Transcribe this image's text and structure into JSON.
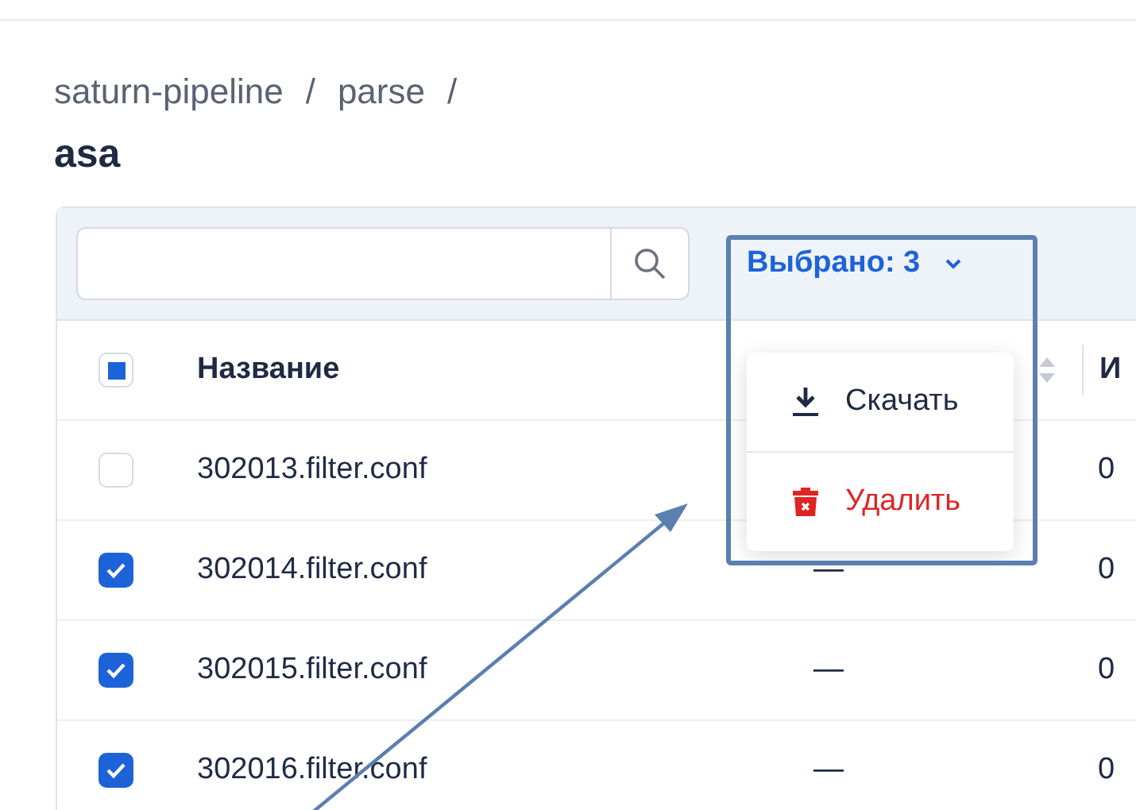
{
  "breadcrumb": [
    {
      "label": "saturn-pipeline",
      "separator": "/"
    },
    {
      "label": "parse",
      "separator": "/"
    }
  ],
  "title": "asa",
  "selection_button": {
    "label": "Выбрано: 3",
    "expanded": true
  },
  "menu": {
    "items": [
      {
        "kind": "download",
        "label": "Скачать"
      },
      {
        "kind": "delete",
        "label": "Удалить"
      }
    ]
  },
  "table": {
    "select_all": {
      "indeterminate": true
    },
    "columns": [
      {
        "kind": "text",
        "label": "Название"
      },
      {
        "kind": "sort"
      },
      {
        "kind": "text",
        "label": "И"
      }
    ],
    "rows": [
      {
        "checked": false,
        "name": "302013.filter.conf",
        "column_3": "0"
      },
      {
        "checked": true,
        "name": "302014.filter.conf",
        "column_2": "—",
        "column_3": "0"
      },
      {
        "checked": true,
        "name": "302015.filter.conf",
        "column_2": "—",
        "column_3": "0"
      },
      {
        "checked": true,
        "name": "302016.filter.conf",
        "column_2": "—",
        "column_3": "0"
      }
    ]
  }
}
